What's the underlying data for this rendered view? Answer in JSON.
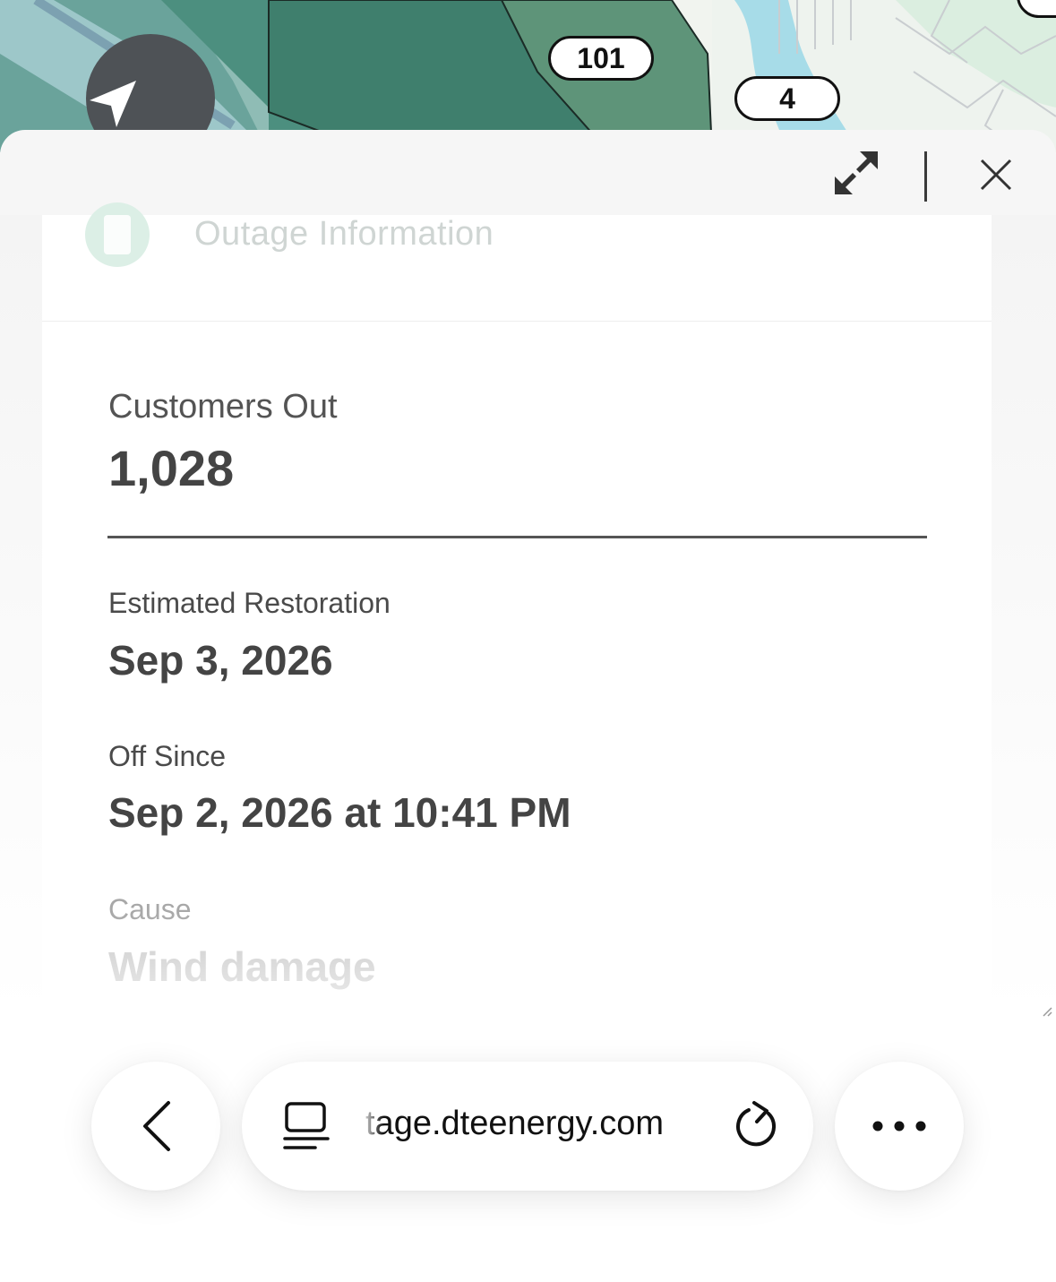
{
  "map": {
    "badges": [
      "101",
      "4"
    ],
    "colors": {
      "area_dark": "#3e7f6c",
      "area_medium": "#5e9479",
      "area_light": "#9ec7bd",
      "water": "#9ad9e6",
      "badge_blue": "#1f63c9"
    },
    "locate_icon": "navigation-arrow-icon"
  },
  "panel": {
    "toolbar": {
      "expand_icon": "expand-arrows-icon",
      "close_icon": "close-icon"
    },
    "card": {
      "header_icon": "outage-icon",
      "title": "Outage Information",
      "customers_out_label": "Customers Out",
      "customers_out_value": "1,028",
      "restoration_label": "Estimated Restoration",
      "restoration_value": "Sep 3, 2026",
      "off_since_label": "Off Since",
      "off_since_value": "Sep 2, 2026 at 10:41 PM",
      "cause_label": "Cause",
      "cause_value": "Wind damage"
    }
  },
  "browser": {
    "back_icon": "chevron-left-icon",
    "reader_icon": "reader-mode-icon",
    "url": "tage.dteenergy.com",
    "reload_icon": "reload-icon",
    "more_icon": "more-dots-icon"
  }
}
